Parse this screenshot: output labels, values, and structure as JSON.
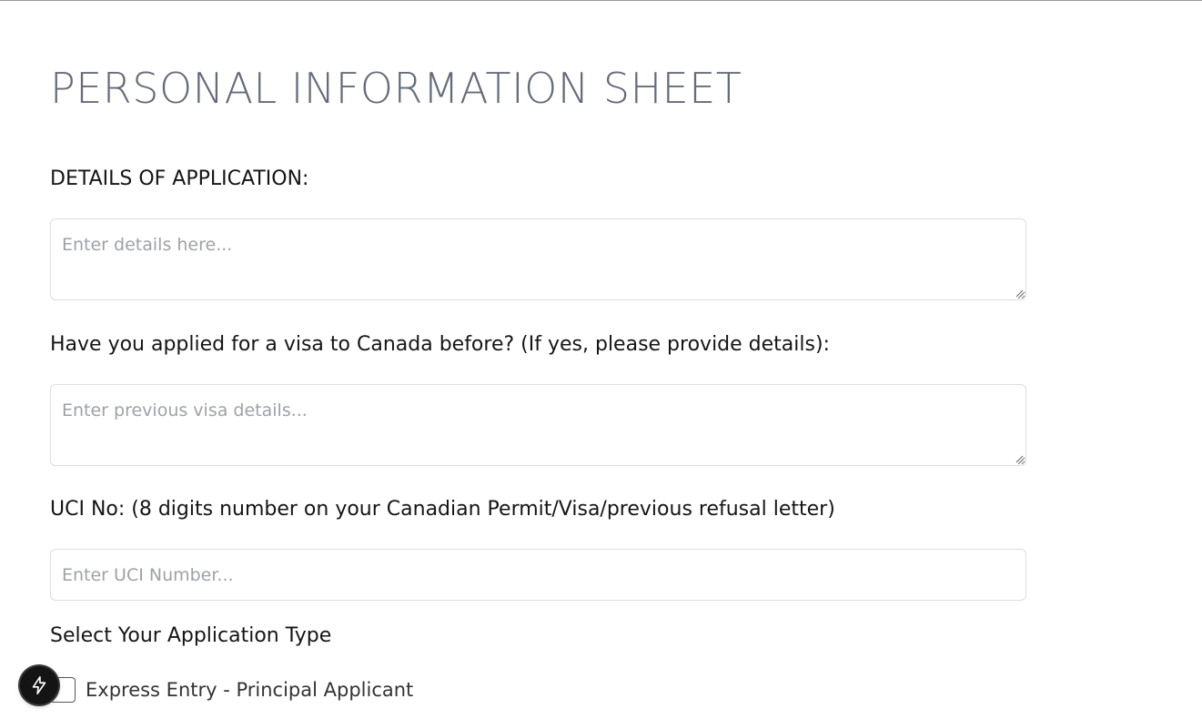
{
  "page": {
    "title": "PERSONAL INFORMATION SHEET"
  },
  "form": {
    "details": {
      "label": "DETAILS OF APPLICATION:",
      "placeholder": "Enter details here...",
      "value": ""
    },
    "previous_visa": {
      "label": "Have you applied for a visa to Canada before? (If yes, please provide details):",
      "placeholder": "Enter previous visa details...",
      "value": ""
    },
    "uci": {
      "label": "UCI No: (8 digits number on your Canadian Permit/Visa/previous refusal letter)",
      "placeholder": "Enter UCI Number...",
      "value": ""
    },
    "application_type": {
      "label": "Select Your Application Type",
      "options": [
        {
          "label": "Express Entry - Principal Applicant",
          "checked": false
        }
      ]
    }
  },
  "widgets": {
    "floating_button_icon": "lightning-bolt-icon"
  },
  "colors": {
    "title": "#646b7a",
    "field_border": "#dcdde1",
    "placeholder": "#9ea1a8",
    "fab_background": "#141414"
  }
}
